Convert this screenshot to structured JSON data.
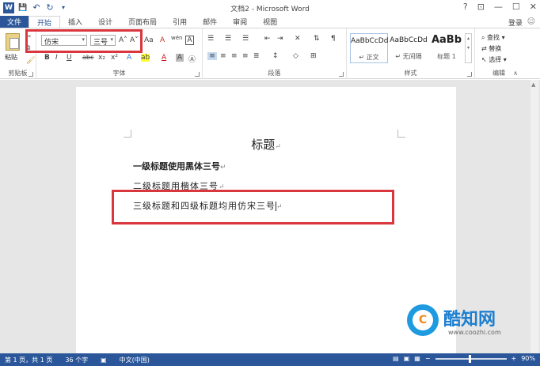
{
  "titlebar": {
    "title": "文档2 - Microsoft Word",
    "logo": "W",
    "save_icon": "💾",
    "undo_icon": "↶",
    "redo_icon": "↻",
    "customize_icon": "▾",
    "help": "?",
    "ribbon_opts": "⊡",
    "minimize": "—",
    "maximize": "☐",
    "close": "✕"
  },
  "tabs": {
    "file": "文件",
    "items": [
      "开始",
      "插入",
      "设计",
      "页面布局",
      "引用",
      "邮件",
      "审阅",
      "视图"
    ],
    "login": "登录"
  },
  "ribbon": {
    "clipboard": {
      "paste": "粘贴",
      "label": "剪贴板"
    },
    "font": {
      "font_name": "仿宋",
      "font_size": "三号",
      "grow": "A˄",
      "shrink": "A˅",
      "case": "Aa",
      "clear": "A",
      "pinyin": "wén",
      "border_char": "A",
      "bold": "B",
      "italic": "I",
      "underline": "U",
      "strike": "abc",
      "subscript": "x₂",
      "superscript": "x²",
      "effects": "A",
      "highlight": "ab",
      "font_color": "A",
      "shading": "A",
      "enclose": "Ⓐ",
      "label": "字体"
    },
    "paragraph": {
      "label": "段落"
    },
    "styles": {
      "items": [
        {
          "sample": "AaBbCcDd",
          "name": "↵ 正文"
        },
        {
          "sample": "AaBbCcDd",
          "name": "↵ 无间隔"
        },
        {
          "sample": "AaBb",
          "name": "标题 1"
        }
      ],
      "label": "样式"
    },
    "editing": {
      "find": "查找",
      "replace": "替换",
      "select": "选择",
      "label": "编辑"
    }
  },
  "document": {
    "title": "标题",
    "line1": "一级标题使用黑体三号",
    "line2": "二级标题用楷体三号",
    "line3": "三级标题和四级标题均用仿宋三号",
    "para_mark": "↵"
  },
  "watermark": {
    "logo_char": "C",
    "brand": "酷知网",
    "url": "www.coozhi.com"
  },
  "statusbar": {
    "page": "第 1 页，共 1 页",
    "words": "36 个字",
    "lang": "中文(中国)",
    "zoom": "90%",
    "minus": "−",
    "plus": "+"
  },
  "colors": {
    "accent": "#2b579a",
    "highlight_box": "#d9363e"
  }
}
